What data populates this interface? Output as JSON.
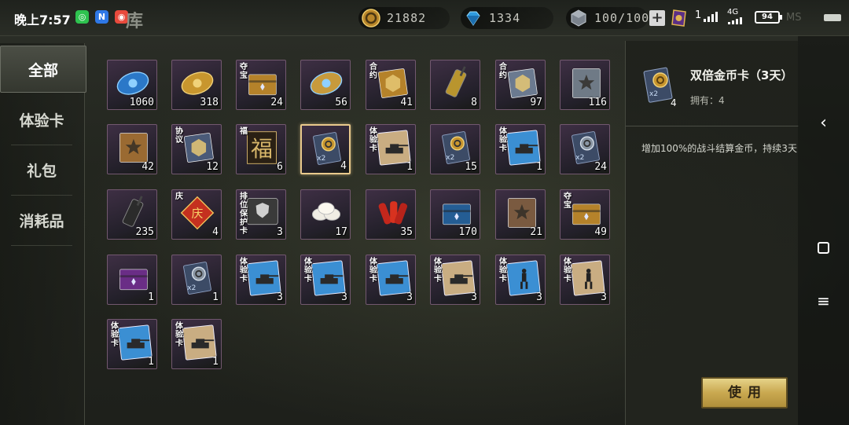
{
  "status_bar": {
    "time": "晚上7:57",
    "network": "4G",
    "signal": "1",
    "battery": "94"
  },
  "header": {
    "title": "库",
    "currencies": [
      {
        "name": "gold",
        "value": "21882",
        "color": "#d4a53a"
      },
      {
        "name": "diamond",
        "value": "1334",
        "color": "#3aa0e0"
      },
      {
        "name": "energy",
        "value": "100/100",
        "color": "#9aa3ad"
      }
    ],
    "add_label": "+"
  },
  "categories": [
    {
      "label": "全部",
      "active": true
    },
    {
      "label": "体验卡",
      "active": false
    },
    {
      "label": "礼包",
      "active": false
    },
    {
      "label": "消耗品",
      "active": false
    }
  ],
  "items": [
    {
      "icon": "blue-ticket-icon",
      "qty": "1060"
    },
    {
      "icon": "gold-ticket-icon",
      "qty": "318"
    },
    {
      "icon": "treasure-chest-card-icon",
      "qty": "24",
      "tag": "夺宝"
    },
    {
      "icon": "blue-gem-ticket-icon",
      "qty": "56"
    },
    {
      "icon": "contract-card-icon",
      "qty": "41",
      "tag": "合约"
    },
    {
      "icon": "walkie-talkie-gold-icon",
      "qty": "8"
    },
    {
      "icon": "contract-card-blue-icon",
      "qty": "97",
      "tag": "合约"
    },
    {
      "icon": "silver-manual-icon",
      "qty": "116"
    },
    {
      "icon": "bronze-manual-icon",
      "qty": "42"
    },
    {
      "icon": "diamond-agreement-icon",
      "qty": "12",
      "tag": "协议"
    },
    {
      "icon": "fortune-card-icon",
      "qty": "6",
      "tag": "福"
    },
    {
      "icon": "double-gold-card-icon",
      "qty": "4",
      "selected": true
    },
    {
      "icon": "experience-card-tank-icon",
      "qty": "1",
      "tag": "体验卡"
    },
    {
      "icon": "double-gold-card-icon",
      "qty": "15"
    },
    {
      "icon": "experience-card-tank-blue-icon",
      "qty": "1",
      "tag": "体验卡"
    },
    {
      "icon": "double-silver-card-icon",
      "qty": "24"
    },
    {
      "icon": "walkie-talkie-icon",
      "qty": "235"
    },
    {
      "icon": "celebration-card-icon",
      "qty": "4",
      "tag": "庆"
    },
    {
      "icon": "rank-protection-card-icon",
      "qty": "3",
      "tag": "排位保护卡"
    },
    {
      "icon": "dumplings-icon",
      "qty": "17"
    },
    {
      "icon": "firecracker-icon",
      "qty": "35"
    },
    {
      "icon": "blue-crate-icon",
      "qty": "170"
    },
    {
      "icon": "brown-manual-icon",
      "qty": "21"
    },
    {
      "icon": "treasure-chest-card-silver-icon",
      "qty": "49",
      "tag": "夺宝"
    },
    {
      "icon": "purple-chest-icon",
      "qty": "1"
    },
    {
      "icon": "double-silver-card-icon",
      "qty": "1"
    },
    {
      "icon": "experience-card-tank-blue-icon",
      "qty": "3",
      "tag": "体验卡"
    },
    {
      "icon": "experience-card-tank-blue-icon",
      "qty": "3",
      "tag": "体验卡"
    },
    {
      "icon": "experience-card-tank-blue-icon",
      "qty": "3",
      "tag": "体验卡"
    },
    {
      "icon": "experience-card-tank-icon",
      "qty": "3",
      "tag": "体验卡"
    },
    {
      "icon": "experience-card-soldier-blue-icon",
      "qty": "3",
      "tag": "体验卡"
    },
    {
      "icon": "experience-card-soldier-icon",
      "qty": "3",
      "tag": "体验卡"
    },
    {
      "icon": "experience-card-tank-blue-icon",
      "qty": "1",
      "tag": "体验卡"
    },
    {
      "icon": "experience-card-tank-icon",
      "qty": "1",
      "tag": "体验卡"
    }
  ],
  "detail": {
    "name": "双倍金币卡（3天）",
    "owned": "拥有：4",
    "owned_count": "4",
    "icon": "double-gold-card-icon",
    "description": "增加100%的战斗结算金币，持续3天",
    "use_label": "使用"
  }
}
